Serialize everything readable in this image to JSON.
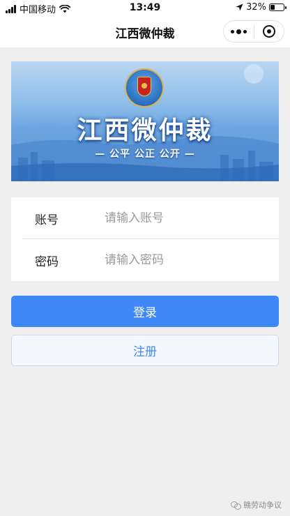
{
  "status_bar": {
    "carrier": "中国移动",
    "time": "13:49",
    "battery": "32%",
    "battery_level": 0.32
  },
  "nav": {
    "title": "江西微仲裁"
  },
  "banner": {
    "title": "江西微仲裁",
    "slogan": "— 公平 公正 公开 —"
  },
  "form": {
    "account": {
      "label": "账号",
      "placeholder": "请输入账号",
      "value": ""
    },
    "password": {
      "label": "密码",
      "placeholder": "请输入密码",
      "value": ""
    }
  },
  "buttons": {
    "login": "登录",
    "register": "注册"
  },
  "watermark": {
    "text": "赣劳动争议"
  },
  "icons": {
    "signal": "signal-icon",
    "wifi": "wifi-icon",
    "location": "location-arrow-icon",
    "battery": "battery-icon",
    "more": "more-dots-icon",
    "close": "target-close-icon",
    "emblem": "arbitration-emblem-icon",
    "wechat": "wechat-icon"
  },
  "colors": {
    "primary": "#3f88f7",
    "background": "#efefef"
  }
}
